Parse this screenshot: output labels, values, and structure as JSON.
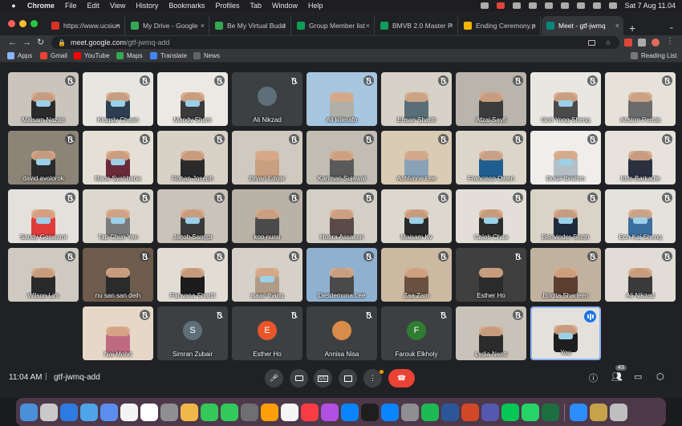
{
  "menubar": {
    "app": "Chrome",
    "menus": [
      "File",
      "Edit",
      "View",
      "History",
      "Bookmarks",
      "Profiles",
      "Tab",
      "Window",
      "Help"
    ],
    "clock": "Sat 7 Aug  11.04"
  },
  "tabs": [
    {
      "title": "https://www.ucsiun",
      "color": "#d93025"
    },
    {
      "title": "My Drive - Google",
      "color": "#34a853"
    },
    {
      "title": "Be My Virtual Budd",
      "color": "#34a853"
    },
    {
      "title": "Group Member list",
      "color": "#0f9d58"
    },
    {
      "title": "BMVB 2.0 Master P",
      "color": "#0f9d58"
    },
    {
      "title": "Ending Ceremony.p",
      "color": "#f4b400"
    },
    {
      "title": "Meet - gtf-jwmq",
      "color": "#00897b",
      "active": true
    }
  ],
  "omnibox": {
    "host": "meet.google.com",
    "path": "/gtf-jwmq-add"
  },
  "bookmarks": [
    {
      "label": "Apps",
      "color": "#8ab4f8"
    },
    {
      "label": "Gmail",
      "color": "#ea4335"
    },
    {
      "label": "YouTube",
      "color": "#ff0000"
    },
    {
      "label": "Maps",
      "color": "#34a853"
    },
    {
      "label": "Translate",
      "color": "#4285f4"
    },
    {
      "label": "News",
      "color": "#5f6368"
    }
  ],
  "reading_list": "Reading List",
  "participants": [
    {
      "name": "Maisam Nazari",
      "bg": "#c9c5bd",
      "shirt": "#2a2a2a",
      "mask": true
    },
    {
      "name": "Kingsly Cheah",
      "bg": "#e8e6e1",
      "shirt": "#2c3e50",
      "mask": true
    },
    {
      "name": "Mandy Shum",
      "bg": "#ece9e4",
      "shirt": "#3a3a3a",
      "mask": true
    },
    {
      "name": "Ali Nikzad",
      "bg": "#3c4043",
      "avatar": "#5f6f7a",
      "plain": true
    },
    {
      "name": "Ali killerafo",
      "bg": "#a7c6e0",
      "shirt": "#b0b0a8",
      "mask": false
    },
    {
      "name": "Ehsan Sharifi",
      "bg": "#d7d2c8",
      "shirt": "#5a6e78",
      "mask": false
    },
    {
      "name": "Afzal Sayfi",
      "bg": "#b9b4ac",
      "shirt": "#3b3b3b",
      "mask": false
    },
    {
      "name": "Goh Yong Sheng",
      "bg": "#e9e7e2",
      "shirt": "#4a4a4a",
      "mask": true
    },
    {
      "name": "Ahston Penda",
      "bg": "#e6e2da",
      "shirt": "#6b6b6b",
      "mask": false
    },
    {
      "name": "david avolorok",
      "bg": "#8c8477",
      "shirt": "#2b2b2b",
      "mask": true
    },
    {
      "name": "Bana Syahbana",
      "bg": "#e5e0d5",
      "shirt": "#6a2a3a",
      "mask": true
    },
    {
      "name": "Rohan Joseph",
      "bg": "#d8d2c6",
      "shirt": "#2a2a2a",
      "mask": false
    },
    {
      "name": "Bryan Edgar",
      "bg": "#cfc9bf",
      "shirt": "#c89f80",
      "mask": false
    },
    {
      "name": "Kariman Sujawal",
      "bg": "#c2bdb3",
      "shirt": "#5a5a5a",
      "mask": false
    },
    {
      "name": "Ashlynne Lee",
      "bg": "#d9cbb4",
      "shirt": "#8aa2b8",
      "mask": false
    },
    {
      "name": "Francisco Owen",
      "bg": "#dcd6ca",
      "shirt": "#1f5f8f",
      "mask": false
    },
    {
      "name": "Doua Ibrahim",
      "bg": "#f0eeea",
      "shirt": "#b4bfc6",
      "mask": true
    },
    {
      "name": "Idris Barkadle",
      "bg": "#e7e3dc",
      "shirt": "#2a3040",
      "mask": false
    },
    {
      "name": "Sandy Goswami",
      "bg": "#e4e1dc",
      "shirt": "#e03b3b",
      "mask": true
    },
    {
      "name": "Tap Chun Yen",
      "bg": "#dcd7cf",
      "shirt": "#7a7a7a",
      "mask": true
    },
    {
      "name": "Jacob Sangpi",
      "bg": "#c9c3b9",
      "shirt": "#3a3a3a",
      "mask": true
    },
    {
      "name": "kop nunu",
      "bg": "#b9b2a6",
      "shirt": "#4b4b4b",
      "mask": false
    },
    {
      "name": "Hoora Assakeri",
      "bg": "#d4cfc6",
      "shirt": "#5a4a48",
      "mask": false
    },
    {
      "name": "Maisam Kv",
      "bg": "#ddd8cf",
      "shirt": "#2b2b2b",
      "mask": true
    },
    {
      "name": "Caleb Chua",
      "bg": "#e3dfd8",
      "shirt": "#2d2d2d",
      "mask": true
    },
    {
      "name": "Benvinder Singh",
      "bg": "#d9d3c8",
      "shirt": "#1f2a3a",
      "mask": true
    },
    {
      "name": "Eon Kai Sheng",
      "bg": "#e5e2dc",
      "shirt": "#3a6fa0",
      "mask": true
    },
    {
      "name": "Wilson Lim",
      "bg": "#cfcac1",
      "shirt": "#2a2a2a",
      "mask": false
    },
    {
      "name": "nu san san deih",
      "bg": "#6d5b4c",
      "shirt": "#2b2b2b",
      "mask": false
    },
    {
      "name": "Parwana Sharifi",
      "bg": "#e2ddd4",
      "shirt": "#1c1c1c",
      "mask": false
    },
    {
      "name": "isaac thang",
      "bg": "#d6d1c8",
      "shirt": "#b09a88",
      "mask": true
    },
    {
      "name": "Desdemona Lee",
      "bg": "#8fb1cf",
      "shirt": "#4a4a4a",
      "mask": false
    },
    {
      "name": "Zaa Zam",
      "bg": "#cbb9a2",
      "shirt": "#6a5040",
      "mask": false
    },
    {
      "name": "Esther Ho",
      "bg": "#3f3f3f",
      "shirt": "#2b2b2b",
      "mask": false
    },
    {
      "name": "Brigita Sharleen",
      "bg": "#c1b29f",
      "shirt": "#5a3f30",
      "mask": false
    },
    {
      "name": "Ali Nikzad",
      "bg": "#e1ddd6",
      "shirt": "#3a3a3a",
      "mask": false
    },
    {
      "name": "Nai Mohd",
      "bg": "#e6d7c6",
      "shirt": "#c06a82",
      "mask": false
    },
    {
      "name": "Simran Zubair",
      "avatarLetter": "S",
      "avatar": "#5f6f7a",
      "plain": true
    },
    {
      "name": "Esther Ho",
      "avatarLetter": "E",
      "avatar": "#e8562a",
      "plain": true
    },
    {
      "name": "Annisa Nisa",
      "avatar": "#d98c4a",
      "plain": true
    },
    {
      "name": "Farouk Elkholy",
      "avatarLetter": "F",
      "avatar": "#2e7d32",
      "plain": true
    },
    {
      "name": "Lydia Nenti",
      "bg": "#c9c2b8",
      "shirt": "#2b2b2b",
      "mask": false
    },
    {
      "name": "You",
      "bg": "#e4e1dc",
      "shirt": "#1e1e1e",
      "mask": true,
      "you": true
    }
  ],
  "bottom": {
    "time": "11:04 AM",
    "separator": "|",
    "meeting_code": "gtf-jwmq-add",
    "people_count": "43"
  },
  "dock_colors": [
    "#4a90d9",
    "#c9c9c9",
    "#2d7be0",
    "#4fa3e8",
    "#5b8def",
    "#f4f4f4",
    "#ffffff",
    "#8e8e93",
    "#f0b84a",
    "#35c759",
    "#32c85a",
    "#6e6e73",
    "#ff9f0a",
    "#f5f5f5",
    "#fc3c44",
    "#b150e2",
    "#0a84ff",
    "#1e1e1e",
    "#0a84ff",
    "#8e8e93",
    "#1db954",
    "#2b579a",
    "#d24726",
    "#5558af",
    "#06c755",
    "#25d366",
    "#1d6f42",
    "#2d8cff",
    "#c8a24a",
    "#bfbfbf"
  ]
}
